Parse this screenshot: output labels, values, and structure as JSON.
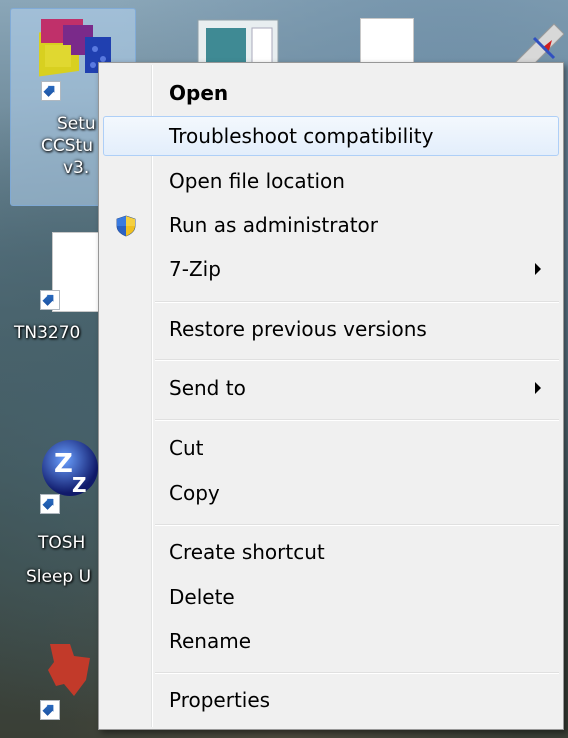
{
  "desktop": {
    "icons": [
      {
        "name": "setup-ccstudio",
        "label_lines": [
          "Setu",
          "CCStu",
          "v3."
        ]
      },
      {
        "name": "tn3270",
        "label_lines": [
          "TN3270"
        ]
      },
      {
        "name": "toshiba-sleep",
        "label_lines": [
          "TOSH",
          "Sleep U"
        ]
      }
    ]
  },
  "menu": {
    "items": [
      {
        "label": "Open",
        "bold": true
      },
      {
        "label": "Troubleshoot compatibility",
        "highlighted": true
      },
      {
        "label": "Open file location"
      },
      {
        "label": "Run as administrator",
        "icon": "uac-shield-icon"
      },
      {
        "label": "7-Zip",
        "submenu": true
      },
      {
        "label": "Restore previous versions"
      },
      {
        "label": "Send to",
        "submenu": true
      },
      {
        "label": "Cut"
      },
      {
        "label": "Copy"
      },
      {
        "label": "Create shortcut"
      },
      {
        "label": "Delete"
      },
      {
        "label": "Rename"
      },
      {
        "label": "Properties"
      }
    ]
  },
  "colors": {
    "menu_bg": "#f0f0f0",
    "hover_border": "#aecff7",
    "selection": "#b6d5f2"
  }
}
